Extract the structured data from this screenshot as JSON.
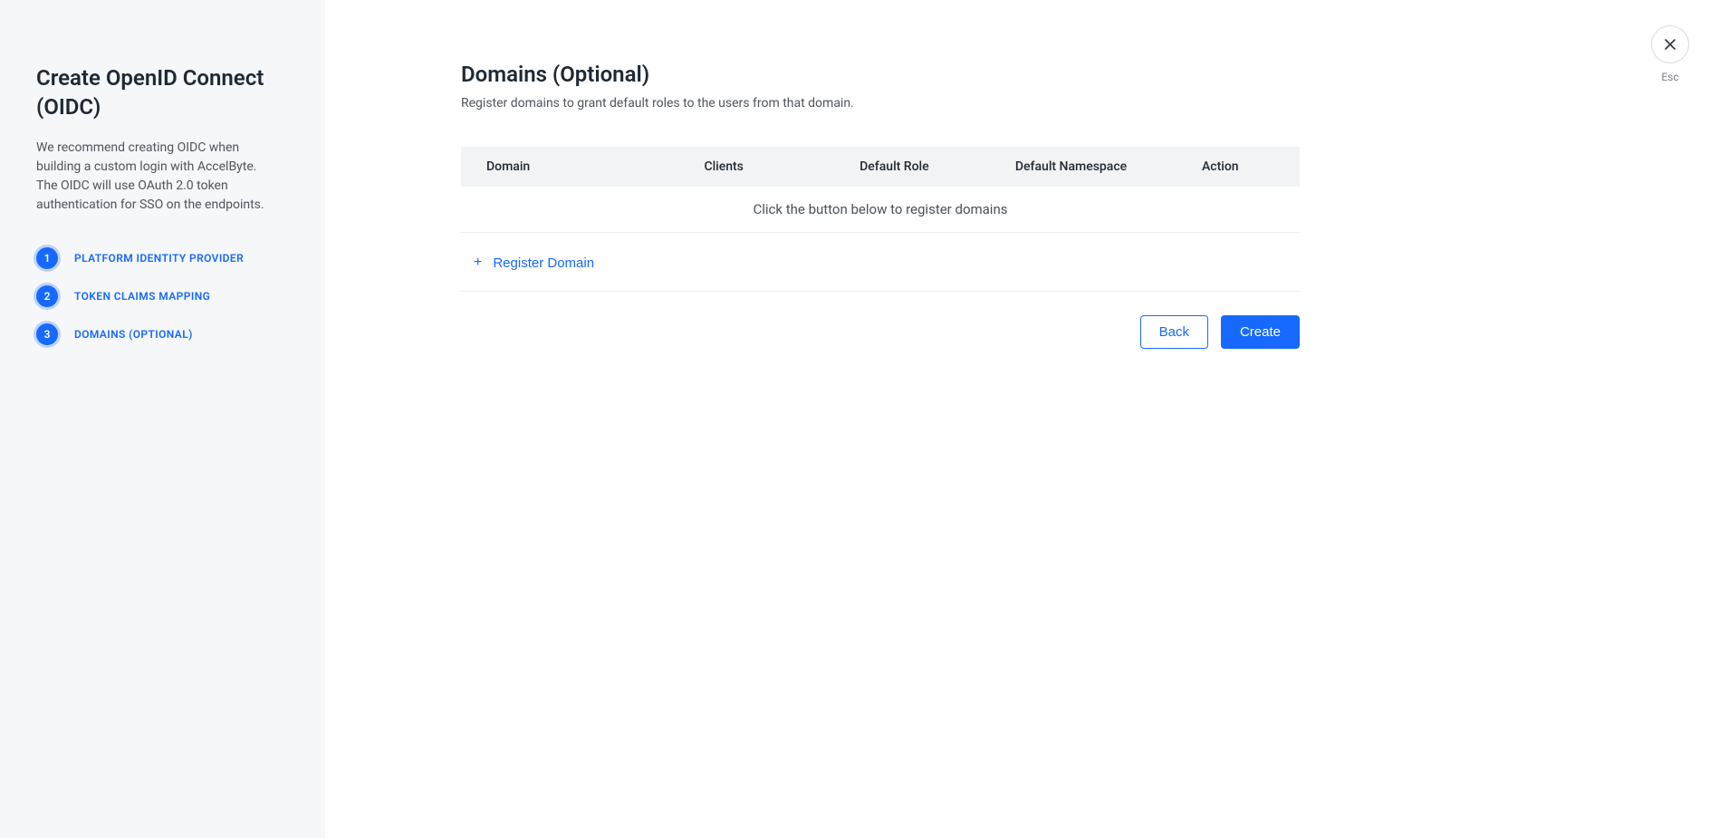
{
  "sidebar": {
    "title": "Create OpenID Connect (OIDC)",
    "description": "We recommend creating OIDC when building a custom login with AccelByte. The OIDC will use OAuth 2.0 token authentication for SSO on the endpoints.",
    "steps": [
      {
        "num": "1",
        "label": "PLATFORM IDENTITY PROVIDER"
      },
      {
        "num": "2",
        "label": "TOKEN CLAIMS MAPPING"
      },
      {
        "num": "3",
        "label": "DOMAINS (OPTIONAL)"
      }
    ]
  },
  "close": {
    "esc": "Esc"
  },
  "main": {
    "title": "Domains (Optional)",
    "description": "Register domains to grant default roles to the users from that domain.",
    "columns": {
      "domain": "Domain",
      "clients": "Clients",
      "role": "Default Role",
      "namespace": "Default Namespace",
      "action": "Action"
    },
    "empty_message": "Click the button below to register domains",
    "register_label": "Register Domain"
  },
  "footer": {
    "back": "Back",
    "create": "Create"
  }
}
